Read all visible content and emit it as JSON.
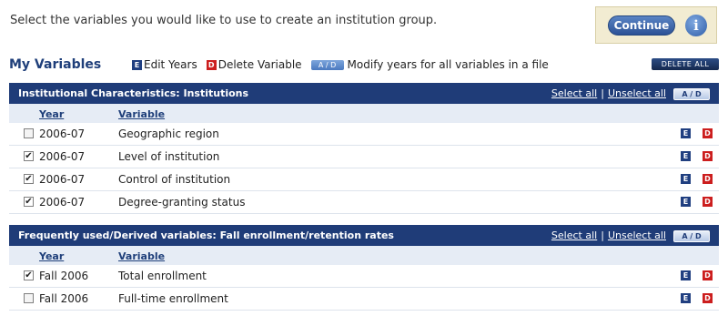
{
  "intro": "Select the variables you would like to use to create an institution group.",
  "continue_label": "Continue",
  "info_glyph": "i",
  "title": "My Variables",
  "legend": {
    "edit_key": "E",
    "edit_label": "Edit Years",
    "delete_key": "D",
    "delete_label": "Delete Variable",
    "modify_key": "A / D",
    "modify_label": "Modify years for all variables in a file"
  },
  "delete_all_label": "DELETE ALL",
  "sections": [
    {
      "title": "Institutional Characteristics: Institutions",
      "select_all": "Select all",
      "separator": "|",
      "unselect_all": "Unselect all",
      "ad_label": "A / D",
      "col_year": "Year",
      "col_variable": "Variable",
      "rows": [
        {
          "checked": false,
          "year": "2006-07",
          "variable": "Geographic region",
          "e": "E",
          "d": "D"
        },
        {
          "checked": true,
          "year": "2006-07",
          "variable": "Level of institution",
          "e": "E",
          "d": "D"
        },
        {
          "checked": true,
          "year": "2006-07",
          "variable": "Control of institution",
          "e": "E",
          "d": "D"
        },
        {
          "checked": true,
          "year": "2006-07",
          "variable": "Degree-granting status",
          "e": "E",
          "d": "D"
        }
      ]
    },
    {
      "title": "Frequently used/Derived variables: Fall enrollment/retention rates",
      "select_all": "Select all",
      "separator": "|",
      "unselect_all": "Unselect all",
      "ad_label": "A / D",
      "col_year": "Year",
      "col_variable": "Variable",
      "rows": [
        {
          "checked": true,
          "year": "Fall 2006",
          "variable": "Total enrollment",
          "e": "E",
          "d": "D"
        },
        {
          "checked": false,
          "year": "Fall 2006",
          "variable": "Full-time enrollment",
          "e": "E",
          "d": "D"
        }
      ]
    }
  ],
  "colors": {
    "header": "#1f3c78",
    "edit": "#203f80",
    "delete": "#cc1e1e"
  }
}
